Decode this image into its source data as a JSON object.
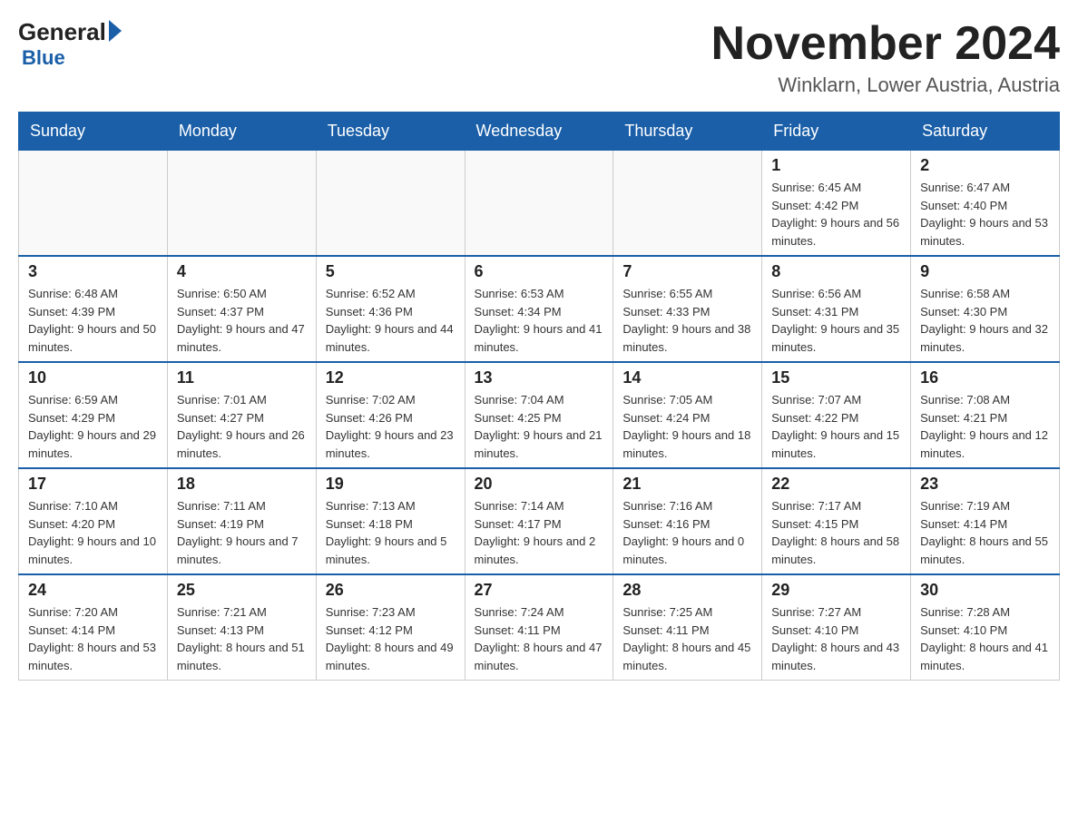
{
  "logo": {
    "text1": "General",
    "text2": "Blue"
  },
  "title": "November 2024",
  "location": "Winklarn, Lower Austria, Austria",
  "days_of_week": [
    "Sunday",
    "Monday",
    "Tuesday",
    "Wednesday",
    "Thursday",
    "Friday",
    "Saturday"
  ],
  "weeks": [
    {
      "days": [
        {
          "number": "",
          "info": ""
        },
        {
          "number": "",
          "info": ""
        },
        {
          "number": "",
          "info": ""
        },
        {
          "number": "",
          "info": ""
        },
        {
          "number": "",
          "info": ""
        },
        {
          "number": "1",
          "info": "Sunrise: 6:45 AM\nSunset: 4:42 PM\nDaylight: 9 hours and 56 minutes."
        },
        {
          "number": "2",
          "info": "Sunrise: 6:47 AM\nSunset: 4:40 PM\nDaylight: 9 hours and 53 minutes."
        }
      ]
    },
    {
      "days": [
        {
          "number": "3",
          "info": "Sunrise: 6:48 AM\nSunset: 4:39 PM\nDaylight: 9 hours and 50 minutes."
        },
        {
          "number": "4",
          "info": "Sunrise: 6:50 AM\nSunset: 4:37 PM\nDaylight: 9 hours and 47 minutes."
        },
        {
          "number": "5",
          "info": "Sunrise: 6:52 AM\nSunset: 4:36 PM\nDaylight: 9 hours and 44 minutes."
        },
        {
          "number": "6",
          "info": "Sunrise: 6:53 AM\nSunset: 4:34 PM\nDaylight: 9 hours and 41 minutes."
        },
        {
          "number": "7",
          "info": "Sunrise: 6:55 AM\nSunset: 4:33 PM\nDaylight: 9 hours and 38 minutes."
        },
        {
          "number": "8",
          "info": "Sunrise: 6:56 AM\nSunset: 4:31 PM\nDaylight: 9 hours and 35 minutes."
        },
        {
          "number": "9",
          "info": "Sunrise: 6:58 AM\nSunset: 4:30 PM\nDaylight: 9 hours and 32 minutes."
        }
      ]
    },
    {
      "days": [
        {
          "number": "10",
          "info": "Sunrise: 6:59 AM\nSunset: 4:29 PM\nDaylight: 9 hours and 29 minutes."
        },
        {
          "number": "11",
          "info": "Sunrise: 7:01 AM\nSunset: 4:27 PM\nDaylight: 9 hours and 26 minutes."
        },
        {
          "number": "12",
          "info": "Sunrise: 7:02 AM\nSunset: 4:26 PM\nDaylight: 9 hours and 23 minutes."
        },
        {
          "number": "13",
          "info": "Sunrise: 7:04 AM\nSunset: 4:25 PM\nDaylight: 9 hours and 21 minutes."
        },
        {
          "number": "14",
          "info": "Sunrise: 7:05 AM\nSunset: 4:24 PM\nDaylight: 9 hours and 18 minutes."
        },
        {
          "number": "15",
          "info": "Sunrise: 7:07 AM\nSunset: 4:22 PM\nDaylight: 9 hours and 15 minutes."
        },
        {
          "number": "16",
          "info": "Sunrise: 7:08 AM\nSunset: 4:21 PM\nDaylight: 9 hours and 12 minutes."
        }
      ]
    },
    {
      "days": [
        {
          "number": "17",
          "info": "Sunrise: 7:10 AM\nSunset: 4:20 PM\nDaylight: 9 hours and 10 minutes."
        },
        {
          "number": "18",
          "info": "Sunrise: 7:11 AM\nSunset: 4:19 PM\nDaylight: 9 hours and 7 minutes."
        },
        {
          "number": "19",
          "info": "Sunrise: 7:13 AM\nSunset: 4:18 PM\nDaylight: 9 hours and 5 minutes."
        },
        {
          "number": "20",
          "info": "Sunrise: 7:14 AM\nSunset: 4:17 PM\nDaylight: 9 hours and 2 minutes."
        },
        {
          "number": "21",
          "info": "Sunrise: 7:16 AM\nSunset: 4:16 PM\nDaylight: 9 hours and 0 minutes."
        },
        {
          "number": "22",
          "info": "Sunrise: 7:17 AM\nSunset: 4:15 PM\nDaylight: 8 hours and 58 minutes."
        },
        {
          "number": "23",
          "info": "Sunrise: 7:19 AM\nSunset: 4:14 PM\nDaylight: 8 hours and 55 minutes."
        }
      ]
    },
    {
      "days": [
        {
          "number": "24",
          "info": "Sunrise: 7:20 AM\nSunset: 4:14 PM\nDaylight: 8 hours and 53 minutes."
        },
        {
          "number": "25",
          "info": "Sunrise: 7:21 AM\nSunset: 4:13 PM\nDaylight: 8 hours and 51 minutes."
        },
        {
          "number": "26",
          "info": "Sunrise: 7:23 AM\nSunset: 4:12 PM\nDaylight: 8 hours and 49 minutes."
        },
        {
          "number": "27",
          "info": "Sunrise: 7:24 AM\nSunset: 4:11 PM\nDaylight: 8 hours and 47 minutes."
        },
        {
          "number": "28",
          "info": "Sunrise: 7:25 AM\nSunset: 4:11 PM\nDaylight: 8 hours and 45 minutes."
        },
        {
          "number": "29",
          "info": "Sunrise: 7:27 AM\nSunset: 4:10 PM\nDaylight: 8 hours and 43 minutes."
        },
        {
          "number": "30",
          "info": "Sunrise: 7:28 AM\nSunset: 4:10 PM\nDaylight: 8 hours and 41 minutes."
        }
      ]
    }
  ]
}
